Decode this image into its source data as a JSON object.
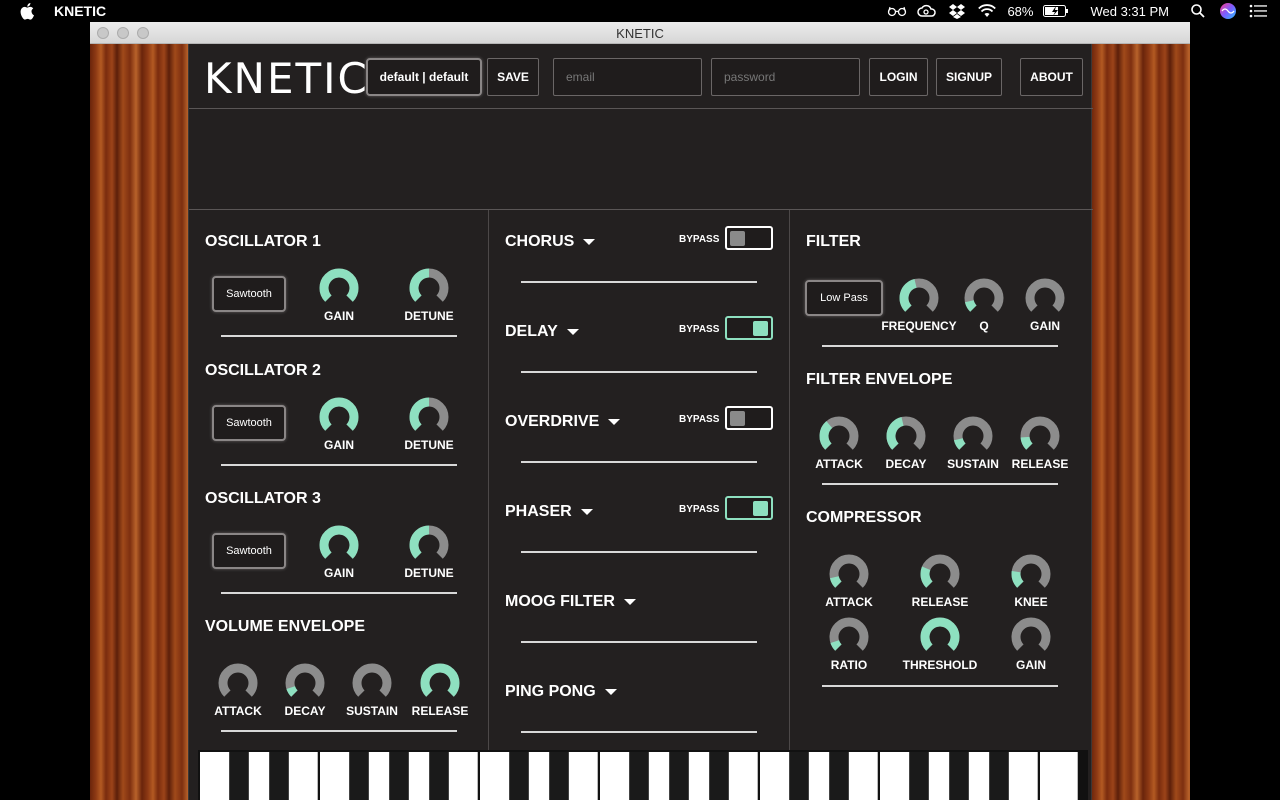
{
  "menubar": {
    "app_name": "KNETIC",
    "battery": "68%",
    "clock": "Wed 3:31 PM",
    "icons": [
      "apple-icon",
      "glasses-icon",
      "creative-cloud-icon",
      "dropbox-icon",
      "wifi-icon",
      "battery-icon",
      "spotlight-icon",
      "siri-icon",
      "notification-center-icon"
    ]
  },
  "window": {
    "title": "KNETIC"
  },
  "header": {
    "logo": "KNETIC",
    "preset": "default | default",
    "save": "SAVE",
    "email_placeholder": "email",
    "password_placeholder": "password",
    "login": "LOGIN",
    "signup": "SIGNUP",
    "about": "ABOUT"
  },
  "accent_color": "#8ee0c0",
  "oscillators": [
    {
      "title": "OSCILLATOR 1",
      "wave": "Sawtooth",
      "gain_label": "GAIN",
      "detune_label": "DETUNE",
      "gain": 1.0,
      "detune": 0.5
    },
    {
      "title": "OSCILLATOR 2",
      "wave": "Sawtooth",
      "gain_label": "GAIN",
      "detune_label": "DETUNE",
      "gain": 1.0,
      "detune": 0.5
    },
    {
      "title": "OSCILLATOR 3",
      "wave": "Sawtooth",
      "gain_label": "GAIN",
      "detune_label": "DETUNE",
      "gain": 1.0,
      "detune": 0.5
    }
  ],
  "volume_envelope": {
    "title": "VOLUME ENVELOPE",
    "knobs": [
      {
        "label": "ATTACK",
        "value": 0.0
      },
      {
        "label": "DECAY",
        "value": 0.1
      },
      {
        "label": "SUSTAIN",
        "value": 0.0
      },
      {
        "label": "RELEASE",
        "value": 1.0
      }
    ]
  },
  "effects": [
    {
      "name": "CHORUS",
      "bypass_label": "BYPASS",
      "bypass_on": false
    },
    {
      "name": "DELAY",
      "bypass_label": "BYPASS",
      "bypass_on": true
    },
    {
      "name": "OVERDRIVE",
      "bypass_label": "BYPASS",
      "bypass_on": false
    },
    {
      "name": "PHASER",
      "bypass_label": "BYPASS",
      "bypass_on": true
    },
    {
      "name": "MOOG FILTER"
    },
    {
      "name": "PING PONG"
    }
  ],
  "filter": {
    "title": "FILTER",
    "type": "Low Pass",
    "knobs": [
      {
        "label": "FREQUENCY",
        "value": 0.45
      },
      {
        "label": "Q",
        "value": 0.12
      },
      {
        "label": "GAIN",
        "value": 0.0
      }
    ]
  },
  "filter_envelope": {
    "title": "FILTER ENVELOPE",
    "knobs": [
      {
        "label": "ATTACK",
        "value": 0.35
      },
      {
        "label": "DECAY",
        "value": 0.45
      },
      {
        "label": "SUSTAIN",
        "value": 0.12
      },
      {
        "label": "RELEASE",
        "value": 0.15
      }
    ]
  },
  "compressor": {
    "title": "COMPRESSOR",
    "knobs": [
      {
        "label": "ATTACK",
        "value": 0.12
      },
      {
        "label": "RELEASE",
        "value": 0.25
      },
      {
        "label": "KNEE",
        "value": 0.2
      },
      {
        "label": "RATIO",
        "value": 0.1
      },
      {
        "label": "THRESHOLD",
        "value": 1.0
      },
      {
        "label": "GAIN",
        "value": 0.0
      }
    ]
  }
}
